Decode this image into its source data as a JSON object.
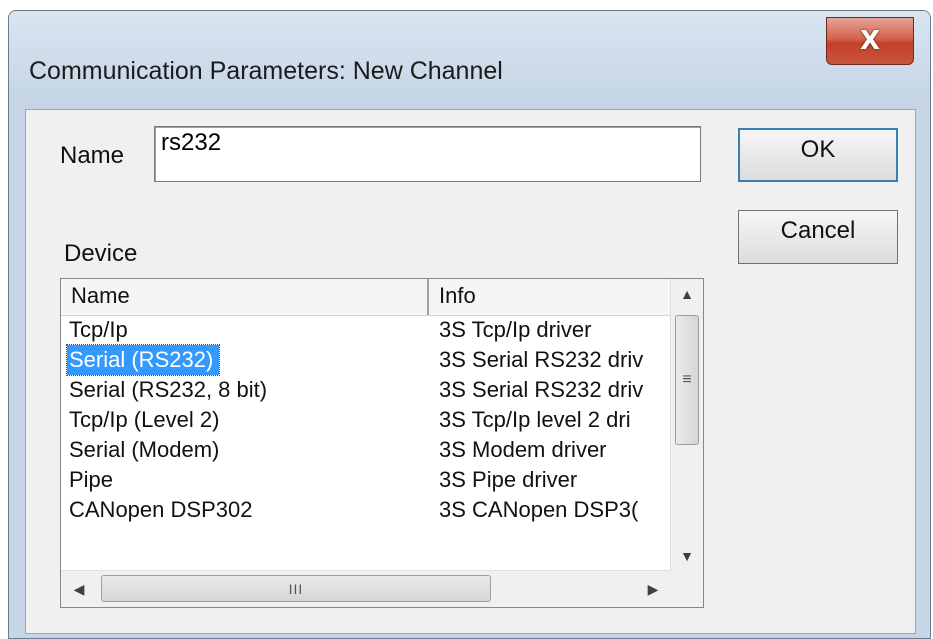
{
  "window": {
    "title": "Communication Parameters: New Channel",
    "close_glyph": "X"
  },
  "name_field": {
    "label": "Name",
    "value": "rs232"
  },
  "buttons": {
    "ok": "OK",
    "cancel": "Cancel"
  },
  "device": {
    "label": "Device",
    "columns": [
      "Name",
      "Info"
    ],
    "rows": [
      {
        "name": "Tcp/Ip",
        "info": "3S Tcp/Ip driver"
      },
      {
        "name": "Serial (RS232)",
        "info": "3S Serial RS232 driv",
        "selected": true
      },
      {
        "name": "Serial (RS232, 8 bit)",
        "info": "3S Serial RS232 driv"
      },
      {
        "name": "Tcp/Ip (Level 2)",
        "info": "3S Tcp/Ip level 2 dri"
      },
      {
        "name": "Serial (Modem)",
        "info": "3S Modem driver"
      },
      {
        "name": "Pipe",
        "info": "3S Pipe driver"
      },
      {
        "name": "CANopen DSP302",
        "info": "3S CANopen DSP3("
      }
    ]
  },
  "scrollbars": {
    "up_glyph": "▲",
    "down_glyph": "▼",
    "left_glyph": "◀",
    "right_glyph": "▶",
    "vgrip": "≡",
    "hgrip": "III"
  }
}
